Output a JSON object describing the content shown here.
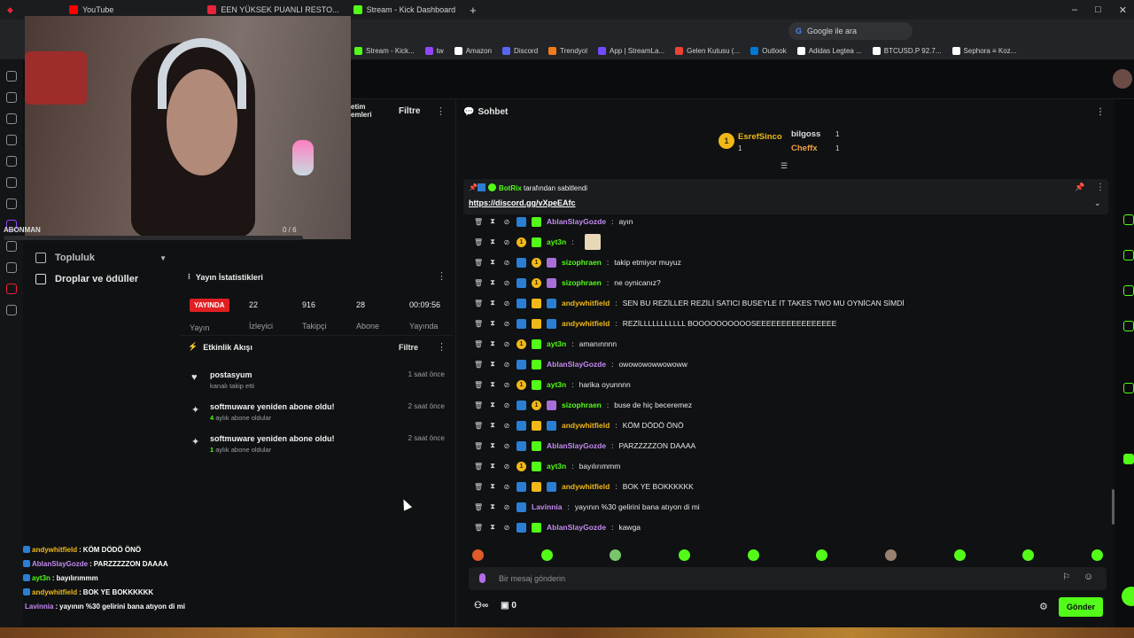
{
  "browser": {
    "tabs": [
      {
        "label": "YouTube",
        "color": "#ff0000"
      },
      {
        "label": "EEN YÜKSEK PUANLI RESTO...",
        "color": "#e8243a"
      },
      {
        "label": "Stream - Kick Dashboard",
        "color": "#53fc18"
      }
    ],
    "search_placeholder": "Google ile ara",
    "bookmarks": [
      {
        "label": "Stream - Kick...",
        "color": "#53fc18"
      },
      {
        "label": "tw",
        "color": "#9146ff"
      },
      {
        "label": "Amazon",
        "color": "#ffffff"
      },
      {
        "label": "Discord",
        "color": "#5865f2"
      },
      {
        "label": "Trendyol",
        "color": "#f27a1a"
      },
      {
        "label": "App | StreamLa...",
        "color": "#6f4cff"
      },
      {
        "label": "Gelen Kutusu (...",
        "color": "#ea4335"
      },
      {
        "label": "Outlook",
        "color": "#0078d4"
      },
      {
        "label": "Adidas Legtea ...",
        "color": "#ffffff"
      },
      {
        "label": "BTCUSD.P 92.7...",
        "color": "#ffffff"
      },
      {
        "label": "Sephora ≡ Koz...",
        "color": "#ffffff"
      }
    ]
  },
  "overlay": {
    "sub_label": "ABONMAN",
    "sub_count": "0 / 6"
  },
  "nav": {
    "topluluk": "Topluluk",
    "drops": "Droplar ve ödüller",
    "mod_title": "etim\nemleri",
    "filter": "Filtre"
  },
  "stats": {
    "title": "Yayın İstatistikleri",
    "live": "YAYINDA",
    "live_label": "Yayın",
    "items": [
      {
        "value": "22",
        "label": "İzleyici"
      },
      {
        "value": "916",
        "label": "Takipçi"
      },
      {
        "value": "28",
        "label": "Abone"
      },
      {
        "value": "00:09:56",
        "label": "Yayında"
      }
    ]
  },
  "activity": {
    "title": "Etkinlik Akışı",
    "filter": "Filtre",
    "items": [
      {
        "icon": "heart-icon",
        "title": "postasyum",
        "sub_num": "",
        "sub": "kanalı takip etti",
        "time": "1 saat önce"
      },
      {
        "icon": "sparkle-icon",
        "title": "softmuware yeniden abone oldu!",
        "sub_num": "4",
        "sub": " aylık abone oldular",
        "time": "2 saat önce"
      },
      {
        "icon": "sparkle-icon",
        "title": "softmuware yeniden abone oldu!",
        "sub_num": "1",
        "sub": " aylık abone oldular",
        "time": "2 saat önce"
      }
    ]
  },
  "overlay_chat": [
    {
      "user": "andywhitfield",
      "text": "KÖM DÖDÖ ÖNÖ",
      "color": "#f0b818"
    },
    {
      "user": "AblanSlayGozde",
      "text": "PARZZZZZON DAAAA",
      "color": "#c58af0"
    },
    {
      "user": "ayt3n",
      "text": "bayılırımmm",
      "color": "#53fc18"
    },
    {
      "user": "andywhitfield",
      "text": "BOK YE BOKKKKKK",
      "color": "#f0b818"
    },
    {
      "user": "Lavinnia",
      "text": "yayının %30 gelirini bana atıyon di mi",
      "color": "#c58af0"
    }
  ],
  "chat": {
    "title": "Sohbet",
    "leaders": [
      {
        "name": "EsrefSinco",
        "count": "1",
        "color": "#f0b818"
      },
      {
        "name": "bilgoss",
        "count": "1",
        "color": "#dddddd"
      },
      {
        "name": "Cheffx",
        "count": "1",
        "color": "#f0a040"
      }
    ],
    "pinned_by_user": "BotRix",
    "pinned_by_text": " tarafından sabitlendi",
    "pinned_link": "https://discord.gg/vXpeEAfc",
    "messages": [
      {
        "user": "AblanSlayGozde",
        "text": "ayın",
        "color": "#c58af0",
        "badges": [
          "b-blue",
          "b-green"
        ]
      },
      {
        "user": "ayt3n",
        "text": "",
        "color": "#53fc18",
        "badges": [
          "b-coin",
          "b-green"
        ]
      },
      {
        "user": "sizophraen",
        "text": "takip etmiyor muyuz",
        "color": "#53fc18",
        "badges": [
          "b-blue",
          "b-coin",
          "b-purple"
        ]
      },
      {
        "user": "sizophraen",
        "text": "ne oynicanız?",
        "color": "#53fc18",
        "badges": [
          "b-blue",
          "b-coin",
          "b-purple"
        ]
      },
      {
        "user": "andywhitfield",
        "text": "SEN BU REZİLLER REZİLİ SATICI BUSEYLE IT TAKES TWO MU OYNİCAN SİMDİ",
        "color": "#f0b818",
        "badges": [
          "b-blue",
          "b-crown",
          "b-blue"
        ]
      },
      {
        "user": "andywhitfield",
        "text": "REZİLLLLLLLLLLL BOOOOOOOOOOSEEEEEEEEEEEEEEEE",
        "color": "#f0b818",
        "badges": [
          "b-blue",
          "b-crown",
          "b-blue"
        ]
      },
      {
        "user": "ayt3n",
        "text": "amanınnnn",
        "color": "#53fc18",
        "badges": [
          "b-coin",
          "b-green"
        ]
      },
      {
        "user": "AblanSlayGozde",
        "text": "owowowowwowoww",
        "color": "#c58af0",
        "badges": [
          "b-blue",
          "b-green"
        ]
      },
      {
        "user": "ayt3n",
        "text": "harika oyunnnn",
        "color": "#53fc18",
        "badges": [
          "b-coin",
          "b-green"
        ]
      },
      {
        "user": "sizophraen",
        "text": "buse de hiç beceremez",
        "color": "#53fc18",
        "badges": [
          "b-blue",
          "b-coin",
          "b-purple"
        ]
      },
      {
        "user": "andywhitfield",
        "text": "KÖM DÖDÖ ÖNÖ",
        "color": "#f0b818",
        "badges": [
          "b-blue",
          "b-crown",
          "b-blue"
        ]
      },
      {
        "user": "AblanSlayGozde",
        "text": "PARZZZZZON DAAAA",
        "color": "#c58af0",
        "badges": [
          "b-blue",
          "b-green"
        ]
      },
      {
        "user": "ayt3n",
        "text": "bayılırımmm",
        "color": "#53fc18",
        "badges": [
          "b-coin",
          "b-green"
        ]
      },
      {
        "user": "andywhitfield",
        "text": "BOK YE BOKKKKKK",
        "color": "#f0b818",
        "badges": [
          "b-blue",
          "b-crown",
          "b-blue"
        ]
      },
      {
        "user": "Lavinnia",
        "text": "yayının %30 gelirini bana atıyon di mi",
        "color": "#c58af0",
        "badges": [
          "b-blue"
        ]
      },
      {
        "user": "AblanSlayGozde",
        "text": "kawga",
        "color": "#c58af0",
        "badges": [
          "b-blue",
          "b-green"
        ]
      }
    ],
    "input_placeholder": "Bir mesaj gönderin",
    "points": "0",
    "send": "Gönder"
  }
}
